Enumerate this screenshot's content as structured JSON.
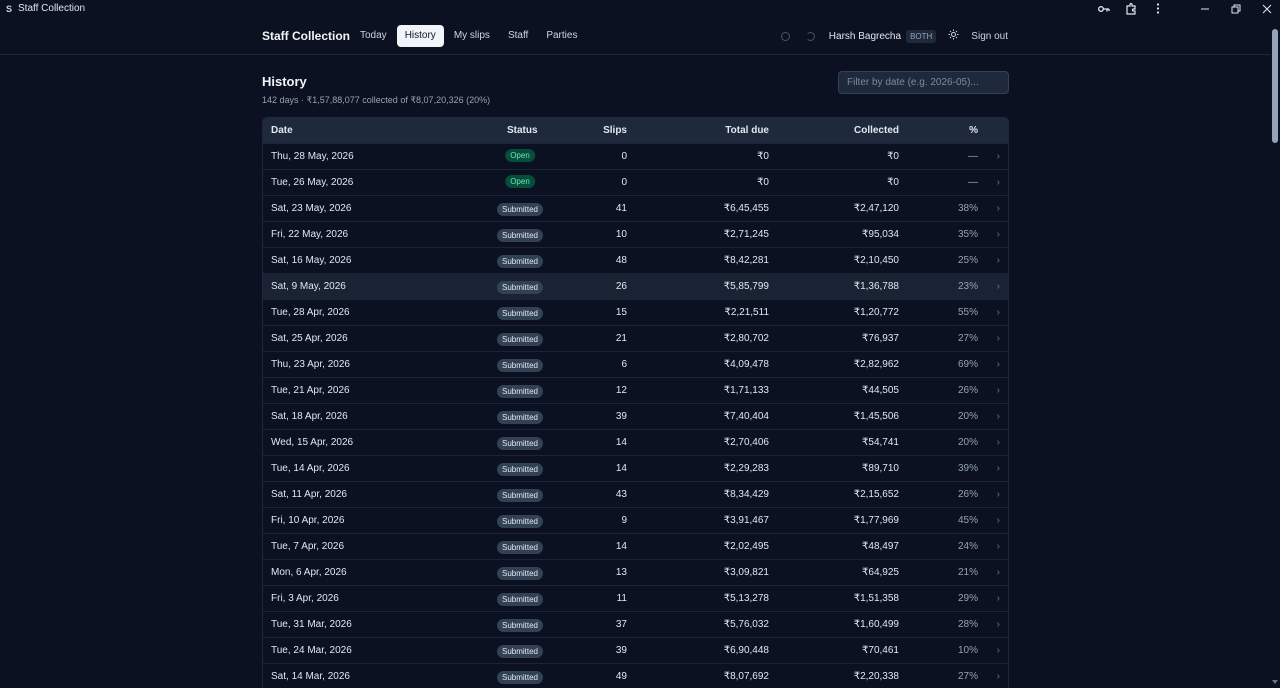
{
  "window": {
    "title": "Staff Collection",
    "icon": "S"
  },
  "header": {
    "brand": "Staff Collection",
    "tabs": [
      {
        "label": "Today",
        "active": false
      },
      {
        "label": "History",
        "active": true
      },
      {
        "label": "My slips",
        "active": false
      },
      {
        "label": "Staff",
        "active": false
      },
      {
        "label": "Parties",
        "active": false
      }
    ],
    "user_name": "Harsh Bagrecha",
    "role": "BOTH",
    "sign_out": "Sign out"
  },
  "page": {
    "title": "History",
    "summary": "142 days · ₹1,57,88,077 collected of ₹8,07,20,326 (20%)",
    "filter_placeholder": "Filter by date (e.g. 2026-05)..."
  },
  "table": {
    "columns": [
      "Date",
      "Status",
      "Slips",
      "Total due",
      "Collected",
      "%"
    ],
    "rows": [
      {
        "date": "Thu, 28 May, 2026",
        "status": "Open",
        "slips": "0",
        "due": "₹0",
        "collected": "₹0",
        "pct": "—"
      },
      {
        "date": "Tue, 26 May, 2026",
        "status": "Open",
        "slips": "0",
        "due": "₹0",
        "collected": "₹0",
        "pct": "—"
      },
      {
        "date": "Sat, 23 May, 2026",
        "status": "Submitted",
        "slips": "41",
        "due": "₹6,45,455",
        "collected": "₹2,47,120",
        "pct": "38%"
      },
      {
        "date": "Fri, 22 May, 2026",
        "status": "Submitted",
        "slips": "10",
        "due": "₹2,71,245",
        "collected": "₹95,034",
        "pct": "35%"
      },
      {
        "date": "Sat, 16 May, 2026",
        "status": "Submitted",
        "slips": "48",
        "due": "₹8,42,281",
        "collected": "₹2,10,450",
        "pct": "25%"
      },
      {
        "date": "Sat, 9 May, 2026",
        "status": "Submitted",
        "slips": "26",
        "due": "₹5,85,799",
        "collected": "₹1,36,788",
        "pct": "23%",
        "highlight": true
      },
      {
        "date": "Tue, 28 Apr, 2026",
        "status": "Submitted",
        "slips": "15",
        "due": "₹2,21,511",
        "collected": "₹1,20,772",
        "pct": "55%"
      },
      {
        "date": "Sat, 25 Apr, 2026",
        "status": "Submitted",
        "slips": "21",
        "due": "₹2,80,702",
        "collected": "₹76,937",
        "pct": "27%"
      },
      {
        "date": "Thu, 23 Apr, 2026",
        "status": "Submitted",
        "slips": "6",
        "due": "₹4,09,478",
        "collected": "₹2,82,962",
        "pct": "69%"
      },
      {
        "date": "Tue, 21 Apr, 2026",
        "status": "Submitted",
        "slips": "12",
        "due": "₹1,71,133",
        "collected": "₹44,505",
        "pct": "26%"
      },
      {
        "date": "Sat, 18 Apr, 2026",
        "status": "Submitted",
        "slips": "39",
        "due": "₹7,40,404",
        "collected": "₹1,45,506",
        "pct": "20%"
      },
      {
        "date": "Wed, 15 Apr, 2026",
        "status": "Submitted",
        "slips": "14",
        "due": "₹2,70,406",
        "collected": "₹54,741",
        "pct": "20%"
      },
      {
        "date": "Tue, 14 Apr, 2026",
        "status": "Submitted",
        "slips": "14",
        "due": "₹2,29,283",
        "collected": "₹89,710",
        "pct": "39%"
      },
      {
        "date": "Sat, 11 Apr, 2026",
        "status": "Submitted",
        "slips": "43",
        "due": "₹8,34,429",
        "collected": "₹2,15,652",
        "pct": "26%"
      },
      {
        "date": "Fri, 10 Apr, 2026",
        "status": "Submitted",
        "slips": "9",
        "due": "₹3,91,467",
        "collected": "₹1,77,969",
        "pct": "45%"
      },
      {
        "date": "Tue, 7 Apr, 2026",
        "status": "Submitted",
        "slips": "14",
        "due": "₹2,02,495",
        "collected": "₹48,497",
        "pct": "24%"
      },
      {
        "date": "Mon, 6 Apr, 2026",
        "status": "Submitted",
        "slips": "13",
        "due": "₹3,09,821",
        "collected": "₹64,925",
        "pct": "21%"
      },
      {
        "date": "Fri, 3 Apr, 2026",
        "status": "Submitted",
        "slips": "11",
        "due": "₹5,13,278",
        "collected": "₹1,51,358",
        "pct": "29%"
      },
      {
        "date": "Tue, 31 Mar, 2026",
        "status": "Submitted",
        "slips": "37",
        "due": "₹5,76,032",
        "collected": "₹1,60,499",
        "pct": "28%"
      },
      {
        "date": "Tue, 24 Mar, 2026",
        "status": "Submitted",
        "slips": "39",
        "due": "₹6,90,448",
        "collected": "₹70,461",
        "pct": "10%"
      },
      {
        "date": "Sat, 14 Mar, 2026",
        "status": "Submitted",
        "slips": "49",
        "due": "₹8,07,692",
        "collected": "₹2,20,338",
        "pct": "27%"
      }
    ],
    "row_arrow": "›"
  },
  "icons": {
    "key": "key-icon",
    "extension": "extension-icon",
    "more": "more-vertical-icon",
    "minimize": "minimize-icon",
    "restore": "restore-icon",
    "close": "close-icon",
    "theme": "sun-icon"
  },
  "colors": {
    "background": "#0b1120",
    "open_badge": "#064e3b",
    "submitted_badge": "#334155"
  }
}
